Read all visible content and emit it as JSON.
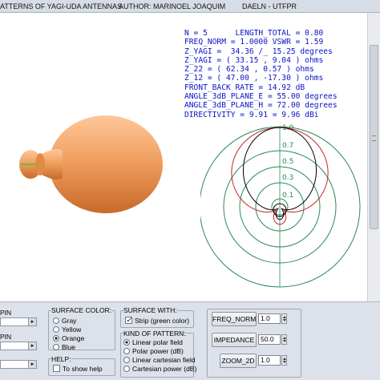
{
  "window": {
    "title_left": "ATTERNS OF YAGI-UDA ANTENNAS",
    "title_author": "AUTHOR: MARINOEL JOAQUIM",
    "title_dept": "DAELN - UTFPR"
  },
  "info_lines": [
    "N = 5      LENGTH_TOTAL = 0.80",
    "FREQ_NORM = 1.0000 VSWR = 1.59",
    "Z_YAGI =  34.36 /_ 15.25 degrees",
    "Z_YAGI = ( 33.15 , 9.04 ) ohms",
    "Z_22 = ( 62.34 , 0.57 ) ohms",
    "Z_12 = ( 47.00 , -17.30 ) ohms",
    "FRONT_BACK RATE = 14.92 dB",
    "ANGLE_3dB_PLANE_E = 55.00 degrees",
    "ANGLE_3dB_PLANE_H = 72.00 degrees",
    "DIRECTIVITY = 9.91 = 9.96 dBi"
  ],
  "polar": {
    "ring_labels": [
      "1.0",
      "0.7",
      "0.5",
      "0.3",
      "0.1"
    ],
    "colors": {
      "grid": "#2a8a5a",
      "label": "#2a8a5a",
      "e_plane": "#cc2222",
      "h_plane": "#000000"
    }
  },
  "pattern3d": {
    "fill": "#f0a060",
    "shade": "#c86a2a",
    "strip": "#33cc33"
  },
  "controls": {
    "spin_label_1": "PIN",
    "spin_label_2": "PIN",
    "surface_color": {
      "title": "SURFACE COLOR:",
      "options": [
        "Gray",
        "Yellow",
        "Orange",
        "Blue"
      ],
      "selected": "Orange"
    },
    "help": {
      "title": "HELP:",
      "show_help": "To show help",
      "checked": false
    },
    "surface_with": {
      "title": "SURFACE WITH:",
      "strip": "Strip (green color)",
      "checked": true
    },
    "kind_of_pattern": {
      "title": "KIND OF PATTERN:",
      "options": [
        "Linear polar field",
        "Polar power (dB)",
        "Linear cartesian field",
        "Cartesian power (dB)"
      ],
      "selected": "Linear polar field"
    },
    "freq_norm": {
      "label": "FREQ_NORM",
      "value": "1.0"
    },
    "impedance": {
      "label": "IMPEDANCE",
      "value": "50.0"
    },
    "zoom_2d": {
      "label": "ZOOM_2D",
      "value": "1.0"
    }
  }
}
